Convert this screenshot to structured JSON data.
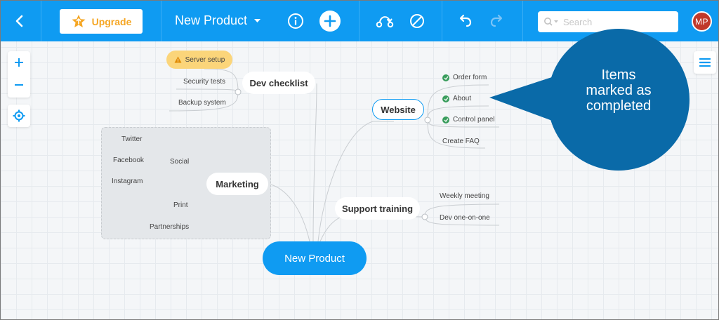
{
  "toolbar": {
    "upgrade_label": "Upgrade",
    "title": "New Product",
    "search_placeholder": "Search",
    "avatar_initials": "MP"
  },
  "mindmap": {
    "root": "New Product",
    "dev_checklist": {
      "label": "Dev checklist",
      "items": [
        "Server setup",
        "Security tests",
        "Backup system"
      ]
    },
    "marketing": {
      "label": "Marketing",
      "social": "Social",
      "social_items": [
        "Twitter",
        "Facebook",
        "Instagram"
      ],
      "print": "Print",
      "partnerships": "Partnerships"
    },
    "website": {
      "label": "Website",
      "items": [
        {
          "label": "Order form",
          "completed": true
        },
        {
          "label": "About",
          "completed": true
        },
        {
          "label": "Control panel",
          "completed": true
        },
        {
          "label": "Create FAQ",
          "completed": false
        }
      ]
    },
    "support_training": {
      "label": "Support training",
      "items": [
        "Weekly meeting",
        "Dev one-on-one"
      ]
    }
  },
  "callout": {
    "text": "Items\nmarked as\ncompleted"
  },
  "colors": {
    "toolbar": "#0f9bf2",
    "upgrade_text": "#f5a623",
    "callout": "#0a6aa8",
    "check": "#3a9d5d",
    "warning_tag": "#fbd57a",
    "avatar": "#c0392b"
  }
}
